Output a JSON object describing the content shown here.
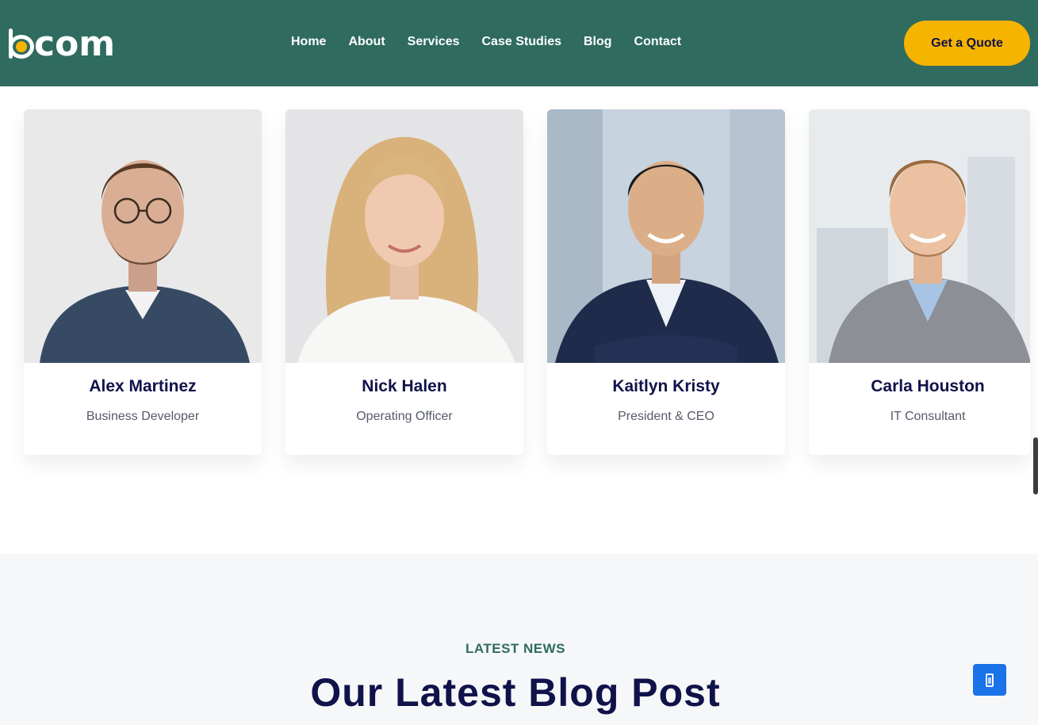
{
  "header": {
    "logo_text": "com",
    "nav": [
      "Home",
      "About",
      "Services",
      "Case Studies",
      "Blog",
      "Contact"
    ],
    "cta_label": "Get a Quote",
    "brand_color": "#2f6b5f",
    "accent_color": "#f5b400"
  },
  "team": [
    {
      "name": "Alex Martinez",
      "role": "Business Developer"
    },
    {
      "name": "Nick Halen",
      "role": "Operating Officer"
    },
    {
      "name": "Kaitlyn Kristy",
      "role": "President & CEO"
    },
    {
      "name": "Carla Houston",
      "role": "IT Consultant"
    }
  ],
  "news": {
    "eyebrow": "LATEST NEWS",
    "title": "Our Latest Blog Post"
  },
  "icons": {
    "accessibility": "accessibility-icon"
  }
}
